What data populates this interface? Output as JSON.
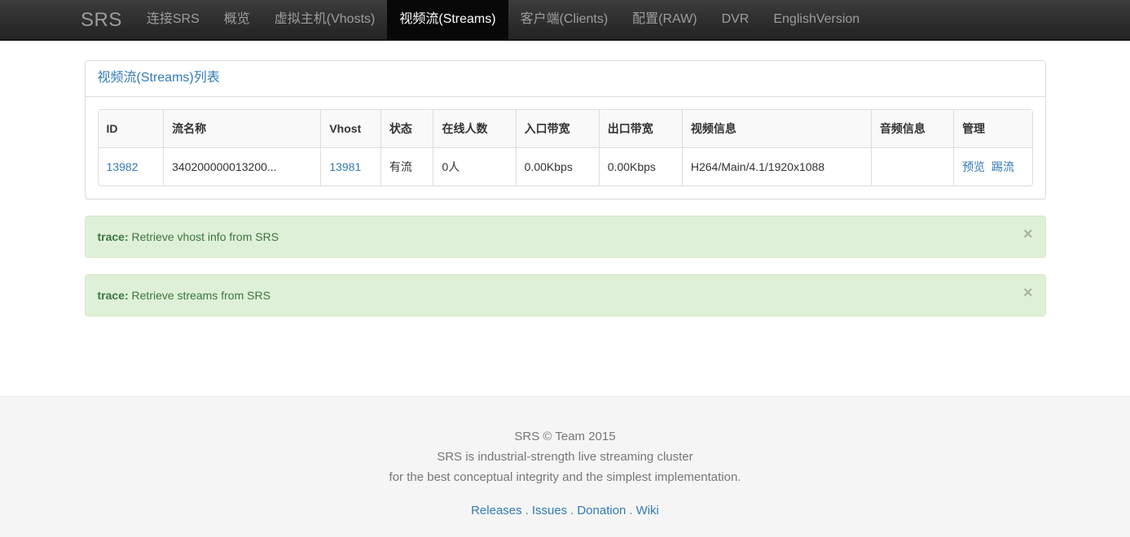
{
  "navbar": {
    "brand": "SRS",
    "items": [
      {
        "label": "连接SRS",
        "active": false
      },
      {
        "label": "概览",
        "active": false
      },
      {
        "label": "虚拟主机(Vhosts)",
        "active": false
      },
      {
        "label": "视频流(Streams)",
        "active": true
      },
      {
        "label": "客户端(Clients)",
        "active": false
      },
      {
        "label": "配置(RAW)",
        "active": false
      },
      {
        "label": "DVR",
        "active": false
      },
      {
        "label": "EnglishVersion",
        "active": false
      }
    ]
  },
  "panel": {
    "title": "视频流(Streams)列表",
    "table": {
      "columns": [
        "ID",
        "流名称",
        "Vhost",
        "状态",
        "在线人数",
        "入口带宽",
        "出口带宽",
        "视频信息",
        "音频信息",
        "管理"
      ],
      "rows": [
        {
          "id": "13982",
          "name": "340200000013200...",
          "vhost": "13981",
          "state": "有流",
          "clients": "0人",
          "in_bandwidth": "0.00Kbps",
          "out_bandwidth": "0.00Kbps",
          "video": "H264/Main/4.1/1920x1088",
          "audio": "",
          "manage": {
            "preview": "预览",
            "kick": "踢流"
          }
        }
      ]
    }
  },
  "alerts": [
    {
      "prefix": "trace:",
      "message": "Retrieve vhost info from SRS",
      "close": "×"
    },
    {
      "prefix": "trace:",
      "message": "Retrieve streams from SRS",
      "close": "×"
    }
  ],
  "footer": {
    "line1": "SRS © Team 2015",
    "line2": "SRS is industrial-strength live streaming cluster",
    "line3": "for the best conceptual integrity and the simplest implementation.",
    "links": [
      {
        "label": "Releases"
      },
      {
        "label": "Issues"
      },
      {
        "label": "Donation"
      },
      {
        "label": "Wiki"
      }
    ],
    "separator": "."
  },
  "colors": {
    "navbar_bg": "#222222",
    "navbar_active_bg": "#080808",
    "link": "#337ab7",
    "alert_bg": "#dff0d8",
    "alert_border": "#d6e9c6",
    "alert_text": "#3c763d",
    "footer_bg": "#f5f5f5",
    "panel_border": "#dddddd"
  }
}
